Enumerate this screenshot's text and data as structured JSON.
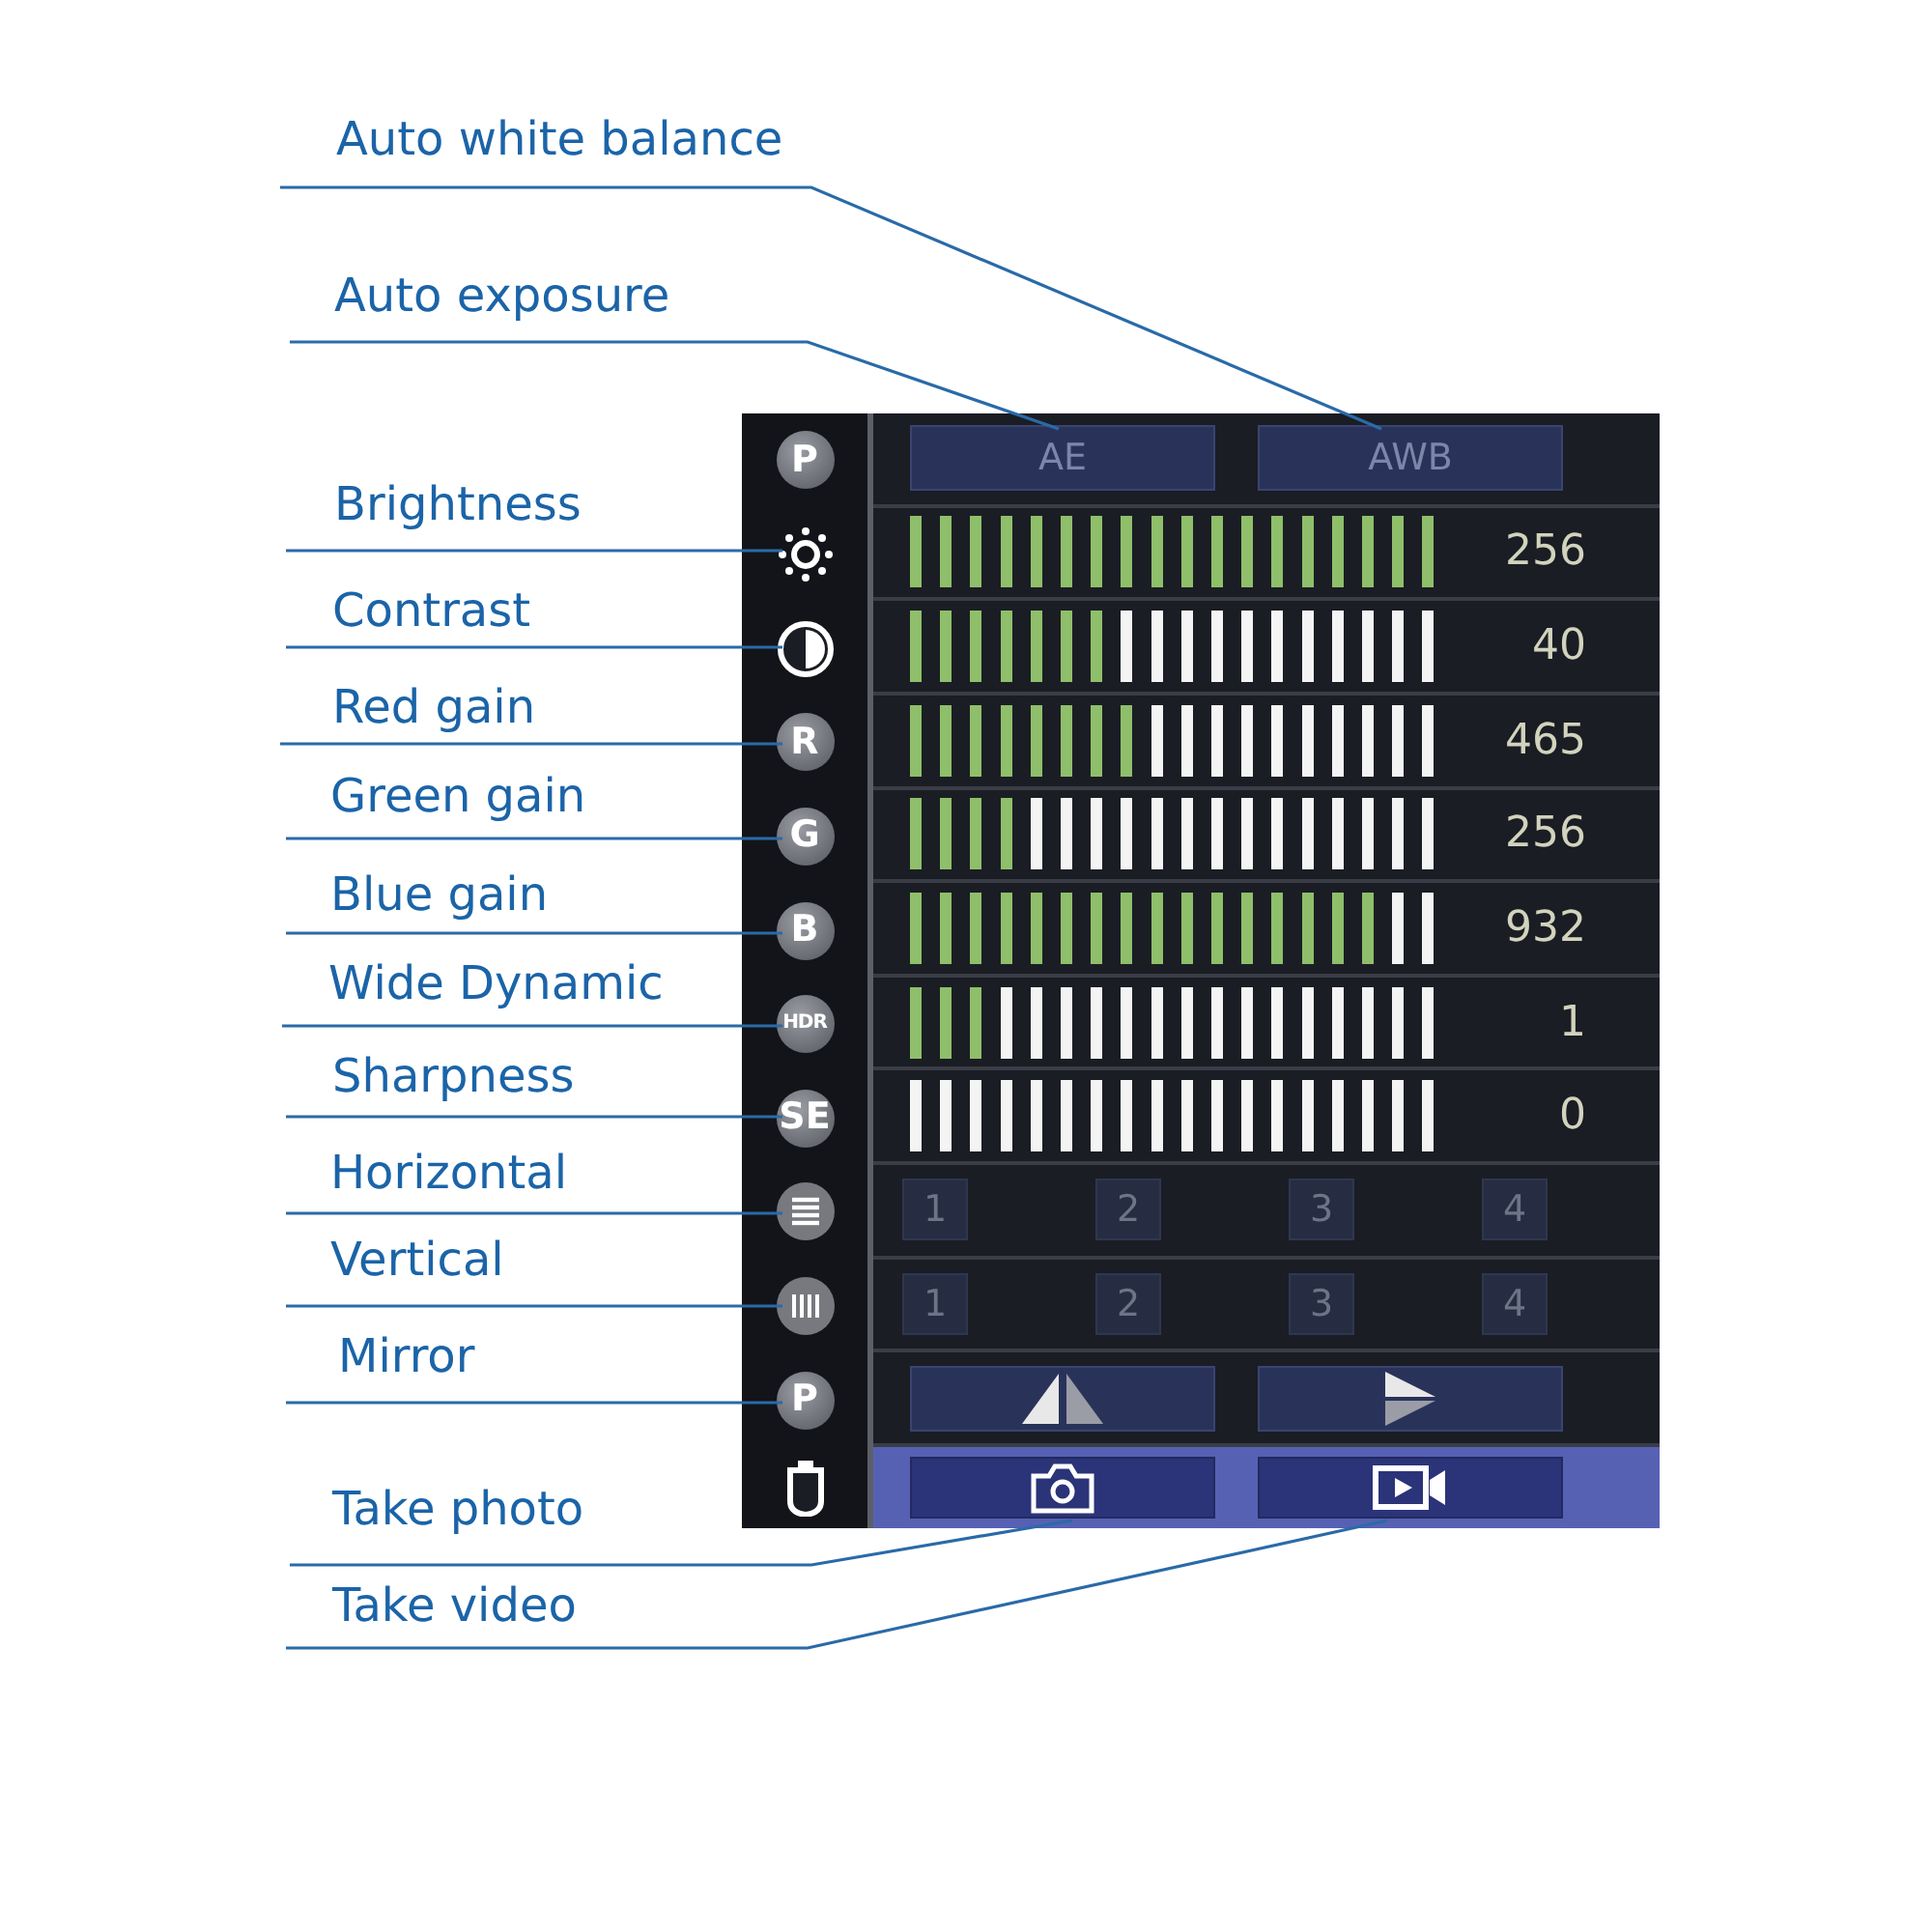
{
  "annotations": [
    {
      "text": "Auto white balance"
    },
    {
      "text": "Auto exposure"
    },
    {
      "text": "Brightness"
    },
    {
      "text": "Contrast"
    },
    {
      "text": "Red gain"
    },
    {
      "text": "Green gain"
    },
    {
      "text": "Blue gain"
    },
    {
      "text": "Wide Dynamic"
    },
    {
      "text": "Sharpness"
    },
    {
      "text": "Horizontal"
    },
    {
      "text": "Vertical"
    },
    {
      "text": "Mirror"
    },
    {
      "text": "Take photo"
    },
    {
      "text": "Take video"
    }
  ],
  "panel": {
    "rows": [
      {
        "kind": "buttons",
        "badge": "P",
        "buttons": [
          "AE",
          "AWB"
        ]
      },
      {
        "kind": "slider",
        "level": 1.0,
        "reading": "256"
      },
      {
        "kind": "slider",
        "level": 0.389,
        "reading": "40"
      },
      {
        "kind": "slider",
        "badge": "R",
        "level": 0.444,
        "reading": "465"
      },
      {
        "kind": "slider",
        "badge": "G",
        "level": 0.222,
        "reading": "256"
      },
      {
        "kind": "slider",
        "badge": "B",
        "level": 0.889,
        "reading": "932"
      },
      {
        "kind": "slider",
        "badge": "HDR",
        "level": 0.167,
        "reading": "1"
      },
      {
        "kind": "slider",
        "badge": "SE",
        "reading": "0"
      },
      {
        "kind": "numbers",
        "options": [
          "1",
          "2",
          "3",
          "4"
        ]
      },
      {
        "kind": "numbers",
        "options": [
          "1",
          "2",
          "3",
          "4"
        ]
      },
      {
        "kind": "mirror",
        "badge": "P"
      },
      {
        "kind": "capture"
      }
    ]
  }
}
